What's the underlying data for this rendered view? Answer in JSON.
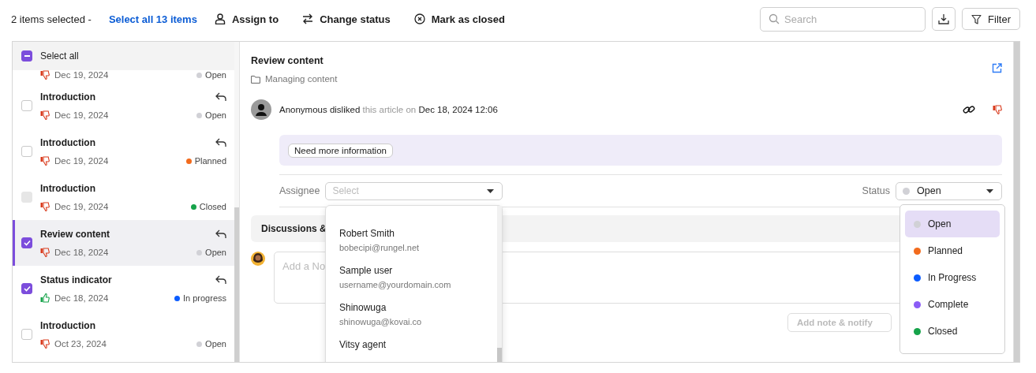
{
  "toolbar": {
    "selection_text": "2 items selected -",
    "select_all_link": "Select all 13 items",
    "actions": [
      {
        "kind": "assign",
        "label": "Assign to"
      },
      {
        "kind": "status",
        "label": "Change status"
      },
      {
        "kind": "close",
        "label": "Mark as closed"
      }
    ],
    "search": {
      "placeholder": "Search"
    },
    "filter_label": "Filter"
  },
  "list": {
    "select_all": {
      "label": "Select all",
      "indeterminate": true
    },
    "items": [
      {
        "liked": false,
        "date": "Dec 19, 2024",
        "status": "Open",
        "color": "#d1d1d6"
      },
      {
        "title": "Introduction",
        "checked": false,
        "disabled": false,
        "selected": false,
        "reply": true,
        "liked": false,
        "date": "Dec 19, 2024",
        "status": "Open",
        "color": "#d1d1d6"
      },
      {
        "title": "Introduction",
        "checked": false,
        "disabled": false,
        "selected": false,
        "reply": true,
        "liked": false,
        "date": "Dec 19, 2024",
        "status": "Planned",
        "color": "#f26b1d"
      },
      {
        "title": "Introduction",
        "checked": false,
        "disabled": true,
        "selected": false,
        "reply": false,
        "liked": false,
        "date": "Dec 19, 2024",
        "status": "Closed",
        "color": "#16a34a"
      },
      {
        "title": "Review content",
        "checked": true,
        "disabled": false,
        "selected": true,
        "reply": true,
        "liked": false,
        "date": "Dec 18, 2024",
        "status": "Open",
        "color": "#d1d1d6"
      },
      {
        "title": "Status indicator",
        "checked": true,
        "disabled": false,
        "selected": false,
        "reply": true,
        "liked": true,
        "date": "Dec 18, 2024",
        "status": "In progress",
        "color": "#0b5cff"
      },
      {
        "title": "Introduction",
        "checked": false,
        "disabled": false,
        "selected": false,
        "reply": false,
        "liked": false,
        "date": "Oct 23, 2024",
        "status": "Open",
        "color": "#d1d1d6"
      }
    ]
  },
  "detail": {
    "title": "Review content",
    "category": "Managing content",
    "activity": {
      "text": "**Anonymous disliked** this article on **Dec 18, 2024 12:06**"
    },
    "feedback_tags": [
      "Need more information"
    ],
    "assignee": {
      "label": "Assignee",
      "placeholder": "Select"
    },
    "status": {
      "label": "Status",
      "value": "Open",
      "color": "#d1d1d6"
    },
    "discussions_tab": "Discussions &",
    "note": {
      "placeholder": "Add a No",
      "button": "Add note & notify"
    },
    "assignee_options": [
      {
        "name": "Robert Smith",
        "email": "bobecipi@rungel.net"
      },
      {
        "name": "Sample user",
        "email": "username@yourdomain.com"
      },
      {
        "name": "Shinowuga",
        "email": "shinowuga@kovai.co"
      },
      {
        "name": "Vitsy agent"
      }
    ],
    "status_options": [
      {
        "label": "Open",
        "color": "#d1d1d6",
        "selected": true
      },
      {
        "label": "Planned",
        "color": "#f26b1d",
        "selected": false
      },
      {
        "label": "In Progress",
        "color": "#0b5cff",
        "selected": false
      },
      {
        "label": "Complete",
        "color": "#8b5cf6",
        "selected": false
      },
      {
        "label": "Closed",
        "color": "#16a34a",
        "selected": false
      }
    ]
  }
}
